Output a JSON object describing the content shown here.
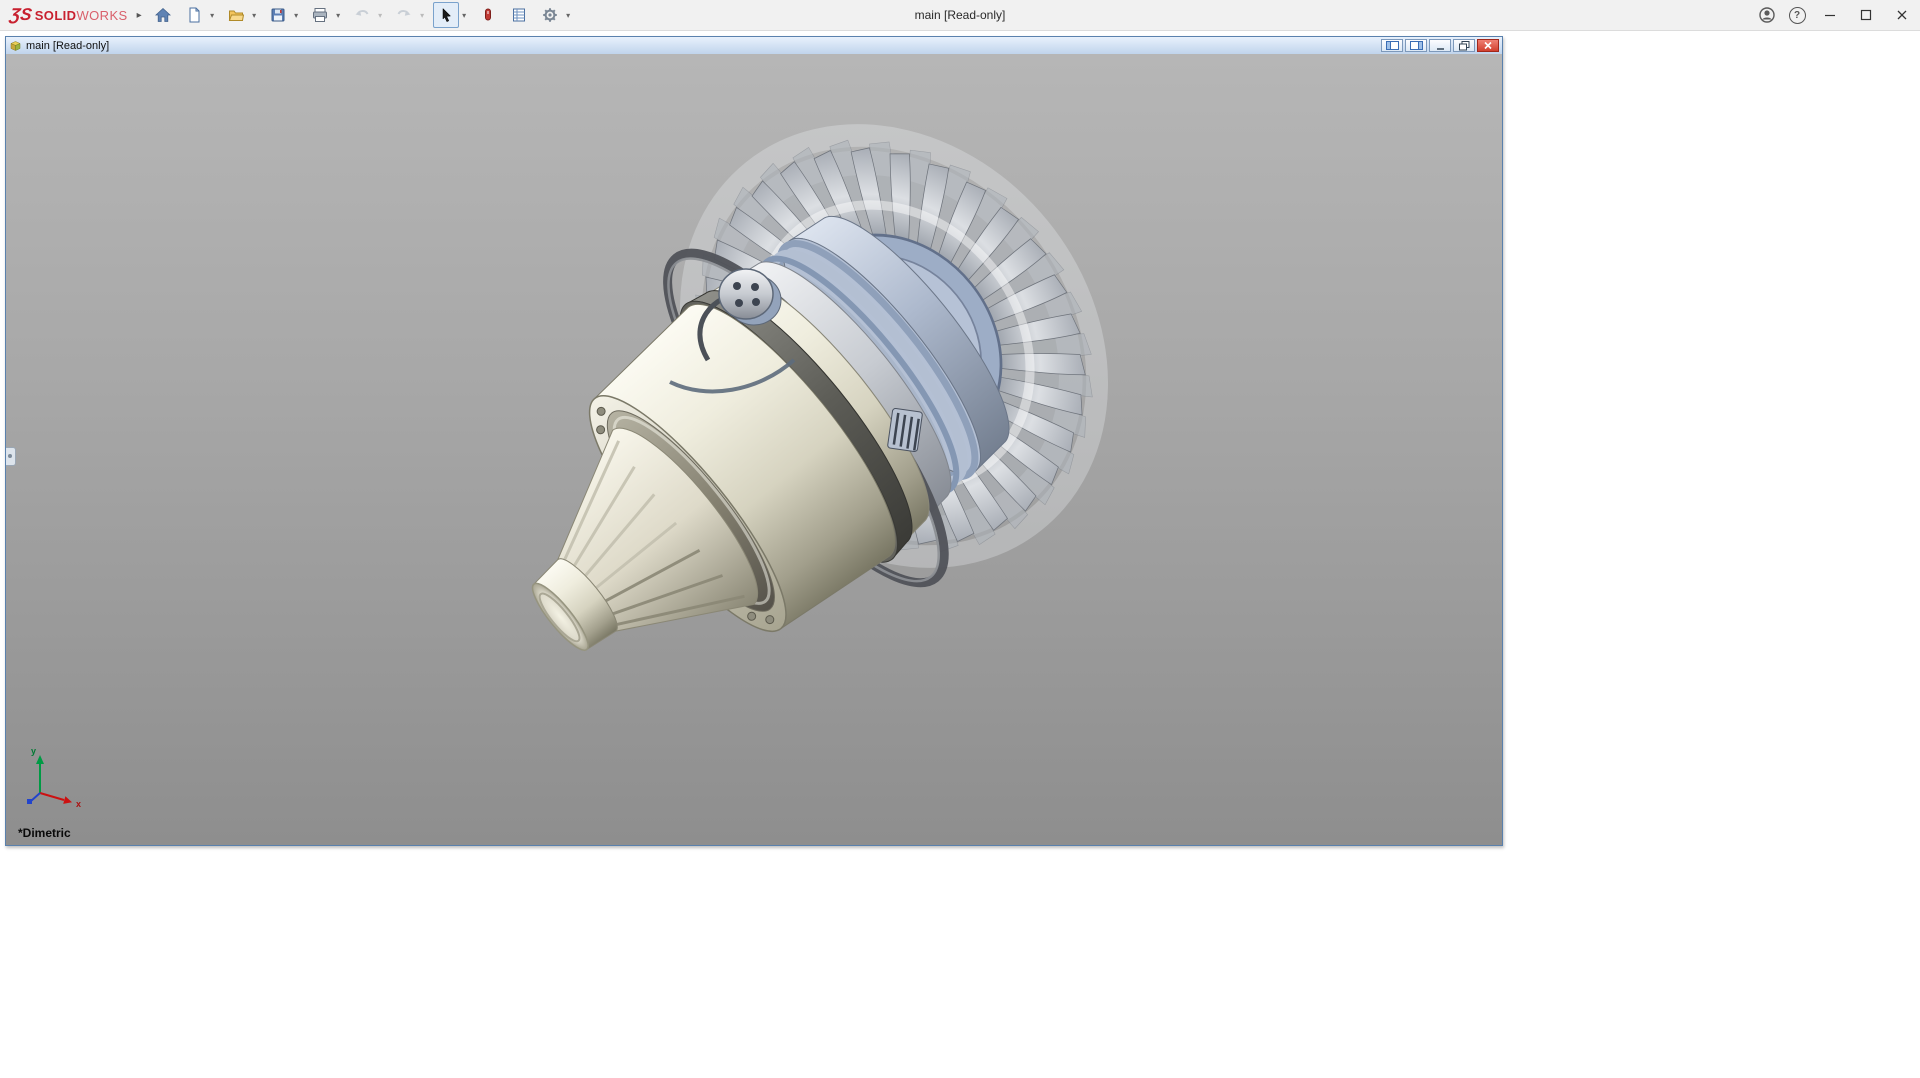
{
  "app": {
    "brand": {
      "logo": "ƷS",
      "name_bold": "SOLID",
      "name_light": "WORKS"
    },
    "flyout_glyph": "▸",
    "title": "main [Read-only]",
    "help_glyph": "?"
  },
  "toolbar": {
    "caret": "▾",
    "items": [
      "home",
      "new-document",
      "open",
      "save",
      "print",
      "undo",
      "redo",
      "select",
      "mouse-gestures",
      "evaluate",
      "options"
    ]
  },
  "document_window": {
    "title": "main [Read-only]"
  },
  "viewport": {
    "view_label": "*Dimetric",
    "triad": {
      "x": "x",
      "y": "y"
    }
  },
  "icons": {
    "home": "house",
    "new-document": "page",
    "open": "folder",
    "save": "floppy-disk",
    "print": "printer",
    "undo": "arrow-curve-left",
    "redo": "arrow-curve-right",
    "select": "cursor-arrow",
    "mouse-gestures": "red-mouse",
    "evaluate": "document-table",
    "options": "gear",
    "account": "person-circle",
    "help": "question-circle",
    "minimize": "–",
    "maximize": "□",
    "close": "✕"
  },
  "colors": {
    "brand_red": "#c8202f",
    "titlebar_bg": "#f1f1f1",
    "doc_titlebar_top": "#e8f1fc",
    "doc_titlebar_bottom": "#c0d4ec",
    "doc_close_red": "#d1402f",
    "viewport_gray_top": "#b6b6b6",
    "viewport_gray_bottom": "#8e8e8e",
    "triad_x": "#cc1111",
    "triad_y": "#009a44",
    "triad_z": "#2244cc"
  }
}
